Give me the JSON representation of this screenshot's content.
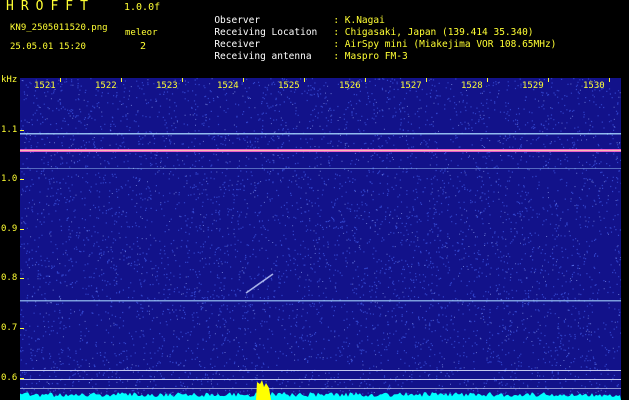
{
  "header": {
    "app_title": "HROFFT",
    "app_version": "1.0.0f",
    "file_name": "KN9_2505011520.png",
    "timestamp": "25.05.01 15:20",
    "mode_label": "meleor",
    "mode_value": "2",
    "info": [
      {
        "label": "Observer",
        "value": ": K.Nagai"
      },
      {
        "label": "Receiving Location",
        "value": ": Chigasaki, Japan (139.414 35.340)"
      },
      {
        "label": "Receiver",
        "value": ": AirSpy mini (Miakejima VOR 108.65MHz)"
      },
      {
        "label": "Receiving antenna",
        "value": ": Maspro FM-3"
      }
    ]
  },
  "plot": {
    "y_unit": "kHz",
    "x_ticks": [
      "1521",
      "1522",
      "1523",
      "1524",
      "1525",
      "1526",
      "1527",
      "1528",
      "1529",
      "1530"
    ],
    "y_ticks": [
      "1.1",
      "1.0",
      "0.9",
      "0.8",
      "0.7",
      "0.6"
    ],
    "colors": {
      "background": "#12128a",
      "noise": "#4a6cff",
      "carrier": "#ff66cc",
      "line": "#a8d8ff",
      "spectrum": "#00ffff",
      "spike": "#ffff00",
      "label": "#ffff33"
    }
  }
}
